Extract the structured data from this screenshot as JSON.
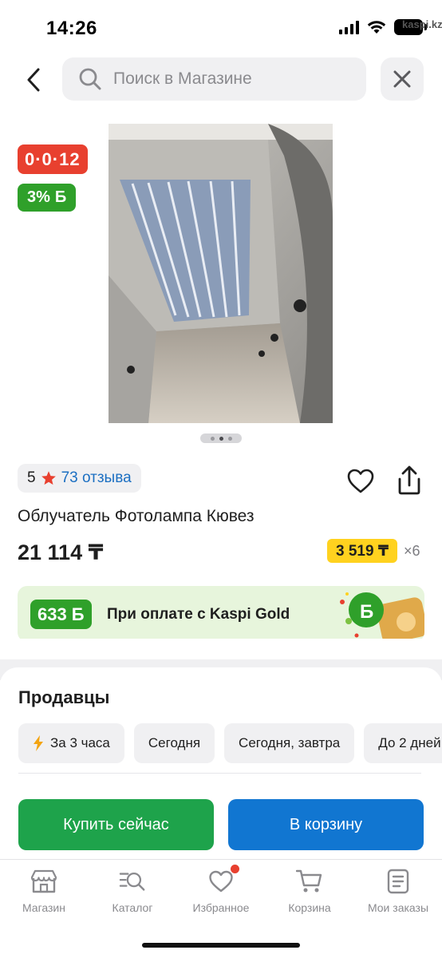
{
  "status_bar": {
    "time": "14:26",
    "carrier_label": "kaspi.kz",
    "icons": [
      "cellular-signal-icon",
      "wifi-icon",
      "battery-icon"
    ]
  },
  "header": {
    "back_icon": "chevron-left-icon",
    "search_placeholder": "Поиск в Магазине",
    "search_icon": "search-icon",
    "close_icon": "close-icon"
  },
  "gallery": {
    "installment_badge": "0·0·12",
    "bonus_badge_value": "3%",
    "bonus_symbol": "Б",
    "pages_total": 3,
    "active_page": 1
  },
  "product": {
    "rating": "5",
    "reviews_label": "73 отзыва",
    "title": "Облучатель Фотолампа Кювез",
    "price": "21 114 ₸",
    "monthly_payment": "3 519 ₸",
    "months": "×6"
  },
  "kaspi_gold": {
    "bonus_amount": "633",
    "bonus_symbol": "Б",
    "text": "При оплате с Kaspi Gold"
  },
  "sellers": {
    "title": "Продавцы",
    "delivery_filters": [
      "За 3 часа",
      "Сегодня",
      "Сегодня, завтра",
      "До 2 дней"
    ]
  },
  "actions": {
    "buy_now": "Купить сейчас",
    "add_to_cart": "В корзину"
  },
  "bottom_nav": {
    "items": [
      {
        "label": "Магазин",
        "icon": "store-icon"
      },
      {
        "label": "Каталог",
        "icon": "catalog-search-icon"
      },
      {
        "label": "Избранное",
        "icon": "heart-icon"
      },
      {
        "label": "Корзина",
        "icon": "cart-icon"
      },
      {
        "label": "Мои заказы",
        "icon": "orders-icon"
      }
    ]
  },
  "colors": {
    "installment_red": "#e8402f",
    "bonus_green": "#2fa02a",
    "monthly_yellow": "#ffd21f",
    "buy_green": "#1ea34b",
    "cart_blue": "#1176d1",
    "link_blue": "#1b6fc2",
    "notification_red": "#e8402f"
  }
}
